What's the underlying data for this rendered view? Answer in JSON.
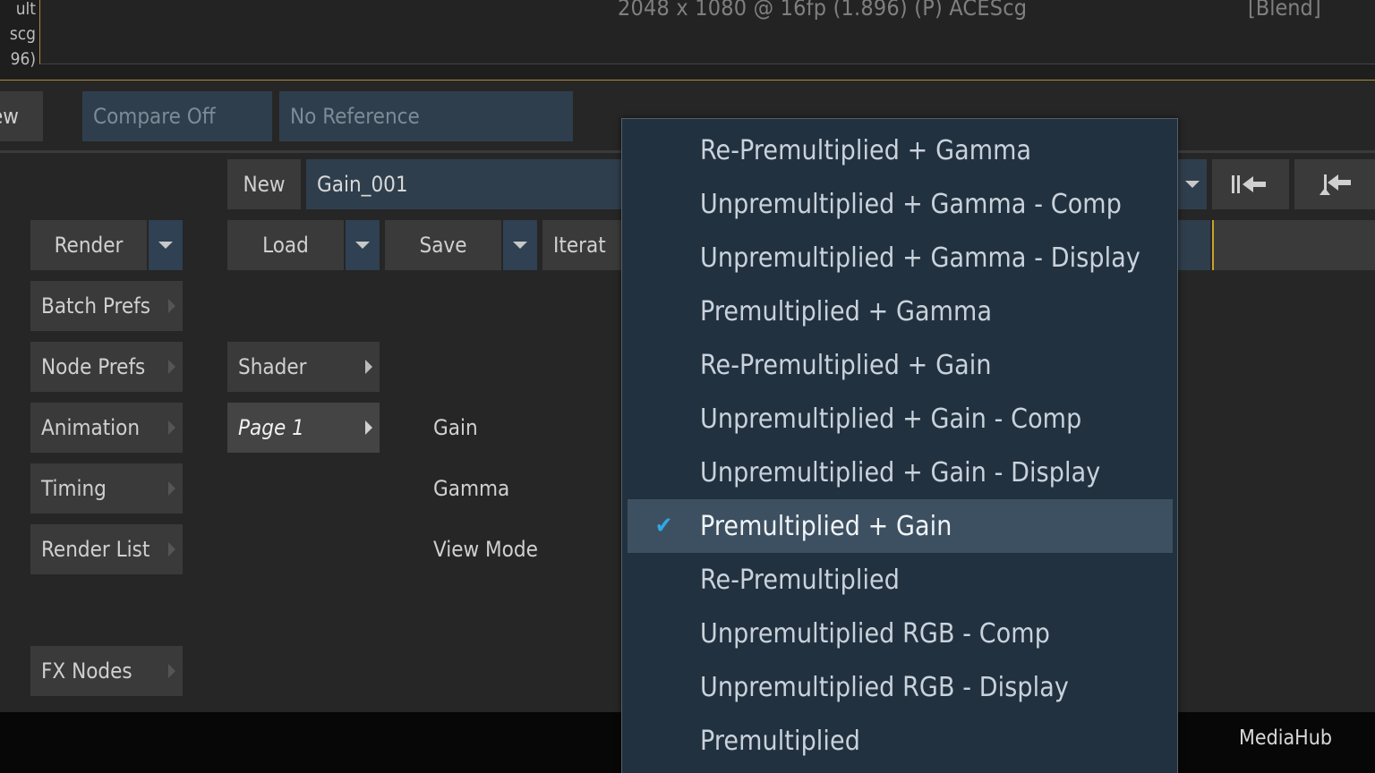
{
  "viewport": {
    "left_clip_text": "ult\nscg\n96)",
    "resolution_info": "2048 x 1080 @ 16fp (1.896) (P) ACEScg",
    "blend_tag": "[Blend]"
  },
  "compare_bar": {
    "view_label": "ew",
    "compare": "Compare Off",
    "reference": "No Reference"
  },
  "setup": {
    "new_label": "New",
    "name_value": "Gain_001"
  },
  "toolbar": {
    "render": "Render",
    "load": "Load",
    "save": "Save",
    "iterate": "Iterat"
  },
  "side_menu": {
    "batch_prefs": "Batch Prefs",
    "node_prefs": "Node Prefs",
    "animation": "Animation",
    "timing": "Timing",
    "render_list": "Render List",
    "fx_nodes": "FX Nodes"
  },
  "pages": {
    "shader": "Shader",
    "page1": "Page 1"
  },
  "params": {
    "gain": "Gain",
    "gamma": "Gamma",
    "view_mode": "View Mode"
  },
  "bottom": {
    "mediahub": "MediaHub"
  },
  "menu": {
    "selected_index": 7,
    "check_glyph": "✔",
    "items": [
      "Re-Premultiplied + Gamma",
      "Unpremultiplied + Gamma - Comp",
      "Unpremultiplied + Gamma - Display",
      "Premultiplied + Gamma",
      "Re-Premultiplied + Gain",
      "Unpremultiplied + Gain - Comp",
      "Unpremultiplied + Gain - Display",
      "Premultiplied + Gain",
      "Re-Premultiplied",
      "Unpremultiplied RGB - Comp",
      "Unpremultiplied RGB - Display",
      "Premultiplied"
    ]
  },
  "colors": {
    "accent_check": "#2ea9e6",
    "viewport_border": "#b28a3a",
    "field_blue": "#2f3e4d"
  }
}
